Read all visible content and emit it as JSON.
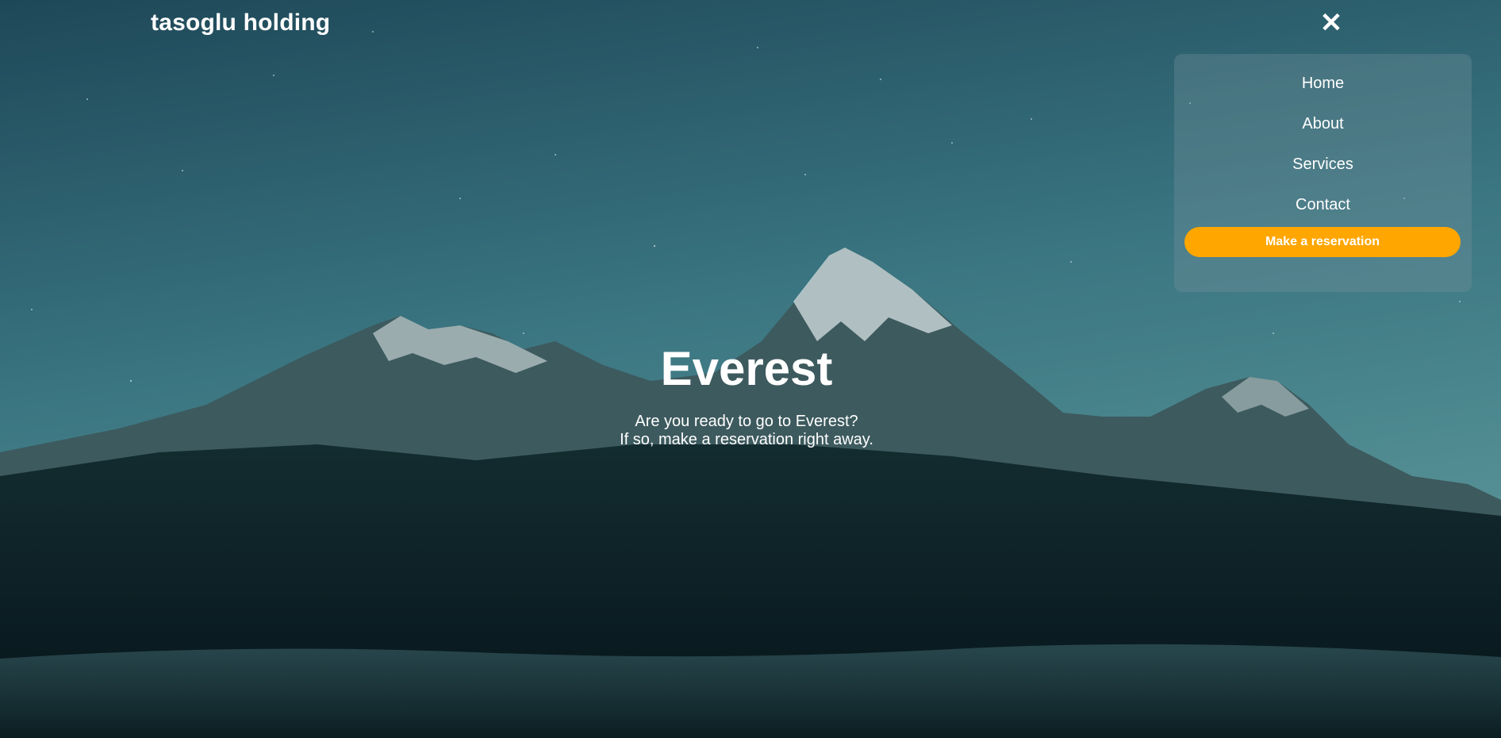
{
  "brand": {
    "name": "tasoglu holding"
  },
  "nav": {
    "close_symbol": "✕",
    "close_icon": "close-icon",
    "items": [
      {
        "label": "Home"
      },
      {
        "label": "About"
      },
      {
        "label": "Services"
      },
      {
        "label": "Contact"
      }
    ],
    "cta_label": "Make a reservation"
  },
  "hero": {
    "title": "Everest",
    "line1": "Are you ready to go to Everest?",
    "line2": "If so, make a reservation right away."
  },
  "colors": {
    "accent": "#ffa600",
    "text": "#ffffff"
  }
}
